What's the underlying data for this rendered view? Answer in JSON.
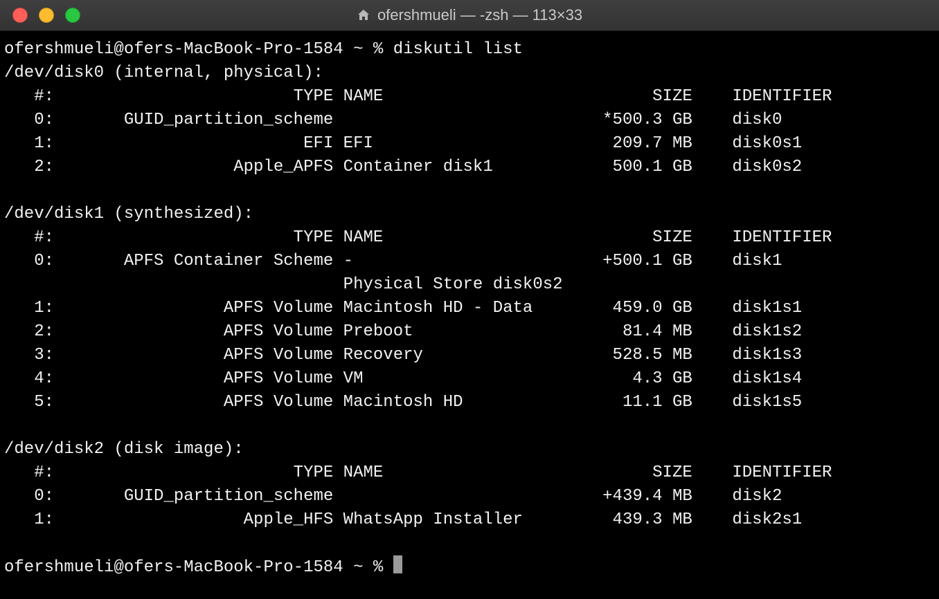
{
  "titlebar": {
    "title": "ofershmueli — -zsh — 113×33"
  },
  "prompt": {
    "user_host": "ofershmueli@ofers-MacBook-Pro-1584",
    "path": "~",
    "symbol": "%"
  },
  "command": "diskutil list",
  "disks": [
    {
      "device": "/dev/disk0",
      "qualifier": "(internal, physical)",
      "header": {
        "num": "#:",
        "type": "TYPE",
        "name": "NAME",
        "size": "SIZE",
        "identifier": "IDENTIFIER"
      },
      "rows": [
        {
          "num": "0:",
          "type": "GUID_partition_scheme",
          "name": "",
          "prefix": "*",
          "size": "500.3 GB",
          "identifier": "disk0"
        },
        {
          "num": "1:",
          "type": "EFI",
          "name": "EFI",
          "prefix": "",
          "size": "209.7 MB",
          "identifier": "disk0s1"
        },
        {
          "num": "2:",
          "type": "Apple_APFS",
          "name": "Container disk1",
          "prefix": "",
          "size": "500.1 GB",
          "identifier": "disk0s2"
        }
      ]
    },
    {
      "device": "/dev/disk1",
      "qualifier": "(synthesized)",
      "header": {
        "num": "#:",
        "type": "TYPE",
        "name": "NAME",
        "size": "SIZE",
        "identifier": "IDENTIFIER"
      },
      "rows": [
        {
          "num": "0:",
          "type": "APFS Container Scheme",
          "name": "-",
          "prefix": "+",
          "size": "500.1 GB",
          "identifier": "disk1"
        },
        {
          "note": "Physical Store disk0s2"
        },
        {
          "num": "1:",
          "type": "APFS Volume",
          "name": "Macintosh HD - Data",
          "prefix": "",
          "size": "459.0 GB",
          "identifier": "disk1s1"
        },
        {
          "num": "2:",
          "type": "APFS Volume",
          "name": "Preboot",
          "prefix": "",
          "size": "81.4 MB",
          "identifier": "disk1s2"
        },
        {
          "num": "3:",
          "type": "APFS Volume",
          "name": "Recovery",
          "prefix": "",
          "size": "528.5 MB",
          "identifier": "disk1s3"
        },
        {
          "num": "4:",
          "type": "APFS Volume",
          "name": "VM",
          "prefix": "",
          "size": "4.3 GB",
          "identifier": "disk1s4"
        },
        {
          "num": "5:",
          "type": "APFS Volume",
          "name": "Macintosh HD",
          "prefix": "",
          "size": "11.1 GB",
          "identifier": "disk1s5"
        }
      ]
    },
    {
      "device": "/dev/disk2",
      "qualifier": "(disk image)",
      "header": {
        "num": "#:",
        "type": "TYPE",
        "name": "NAME",
        "size": "SIZE",
        "identifier": "IDENTIFIER"
      },
      "rows": [
        {
          "num": "0:",
          "type": "GUID_partition_scheme",
          "name": "",
          "prefix": "+",
          "size": "439.4 MB",
          "identifier": "disk2"
        },
        {
          "num": "1:",
          "type": "Apple_HFS",
          "name": "WhatsApp Installer",
          "prefix": "",
          "size": "439.3 MB",
          "identifier": "disk2s1"
        }
      ]
    }
  ]
}
